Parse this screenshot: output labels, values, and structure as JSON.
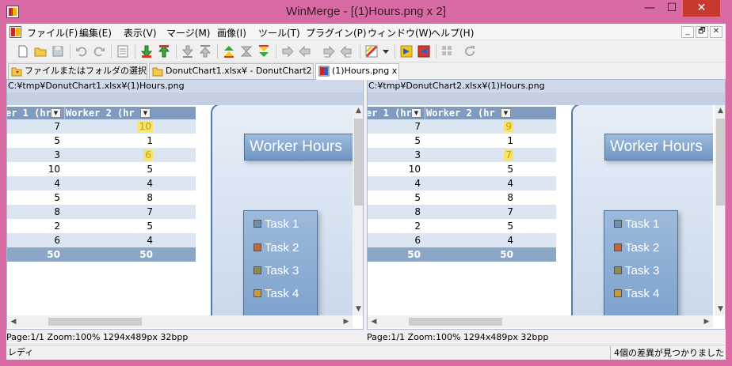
{
  "window": {
    "title": "WinMerge - [(1)Hours.png x 2]",
    "minimize": "—",
    "maximize": "☐",
    "close": "✕"
  },
  "menu": {
    "items": [
      "ファイル(F)",
      "編集(E)",
      "表示(V)",
      "マージ(M)",
      "画像(I)",
      "ツール(T)",
      "プラグイン(P)",
      "ウィンドウ(W)",
      "ヘルプ(H)"
    ],
    "mdi": [
      "_",
      "🗗",
      "✕"
    ]
  },
  "toolbar": {
    "icons": [
      "new-icon",
      "open-icon",
      "save-icon",
      "undo-icon",
      "redo-icon",
      "view-icon",
      "next-diff-icon",
      "prev-diff-icon",
      "first-diff-icon",
      "last-diff-icon",
      "all-left-icon",
      "current-icon",
      "all-right-icon",
      "copy-right-icon",
      "copy-left-icon",
      "copy-right-advance-icon",
      "copy-left-advance-icon",
      "options-icon",
      "dropdown-icon",
      "compare-icon",
      "compare2-icon",
      "grid-icon",
      "refresh-icon"
    ]
  },
  "tabs": [
    {
      "label": "ファイルまたはフォルダの選択..."
    },
    {
      "label": "DonutChart1.xlsx¥ - DonutChart2.xlsx¥"
    },
    {
      "label": "(1)Hours.png x 2"
    }
  ],
  "panes": [
    {
      "path": "C:¥tmp¥DonutChart1.xlsx¥(1)Hours.png",
      "header": {
        "col1": "er 1 (hr",
        "col2": "Worker 2 (hr"
      },
      "rows": [
        {
          "a": "7",
          "b": "10",
          "diff": true
        },
        {
          "a": "5",
          "b": "1",
          "diff": false
        },
        {
          "a": "3",
          "b": "6",
          "diff": true
        },
        {
          "a": "10",
          "b": "5",
          "diff": false
        },
        {
          "a": "4",
          "b": "4",
          "diff": false
        },
        {
          "a": "5",
          "b": "8",
          "diff": false
        },
        {
          "a": "8",
          "b": "7",
          "diff": false
        },
        {
          "a": "2",
          "b": "5",
          "diff": false
        },
        {
          "a": "6",
          "b": "4",
          "diff": false
        }
      ],
      "total": {
        "a": "50",
        "b": "50"
      },
      "chart_title": "Worker Hours",
      "legend": [
        "Task 1",
        "Task 2",
        "Task 3",
        "Task 4"
      ],
      "status": "Page:1/1 Zoom:100% 1294x489px 32bpp"
    },
    {
      "path": "C:¥tmp¥DonutChart2.xlsx¥(1)Hours.png",
      "header": {
        "col1": "er 1 (hr",
        "col2": "Worker 2 (hr"
      },
      "rows": [
        {
          "a": "7",
          "b": "9",
          "diff": true
        },
        {
          "a": "5",
          "b": "1",
          "diff": false
        },
        {
          "a": "3",
          "b": "7",
          "diff": true
        },
        {
          "a": "10",
          "b": "5",
          "diff": false
        },
        {
          "a": "4",
          "b": "4",
          "diff": false
        },
        {
          "a": "5",
          "b": "8",
          "diff": false
        },
        {
          "a": "8",
          "b": "7",
          "diff": false
        },
        {
          "a": "2",
          "b": "5",
          "diff": false
        },
        {
          "a": "6",
          "b": "4",
          "diff": false
        }
      ],
      "total": {
        "a": "50",
        "b": "50"
      },
      "chart_title": "Worker Hours",
      "legend": [
        "Task 1",
        "Task 2",
        "Task 3",
        "Task 4"
      ],
      "status": "Page:1/1 Zoom:100% 1294x489px 32bpp"
    }
  ],
  "legend_colors": [
    "#6f8fae",
    "#c8643a",
    "#8a8d4f",
    "#c79a3c"
  ],
  "status": {
    "ready": "レディ",
    "diff_count": "4個の差異が見つかりました"
  }
}
